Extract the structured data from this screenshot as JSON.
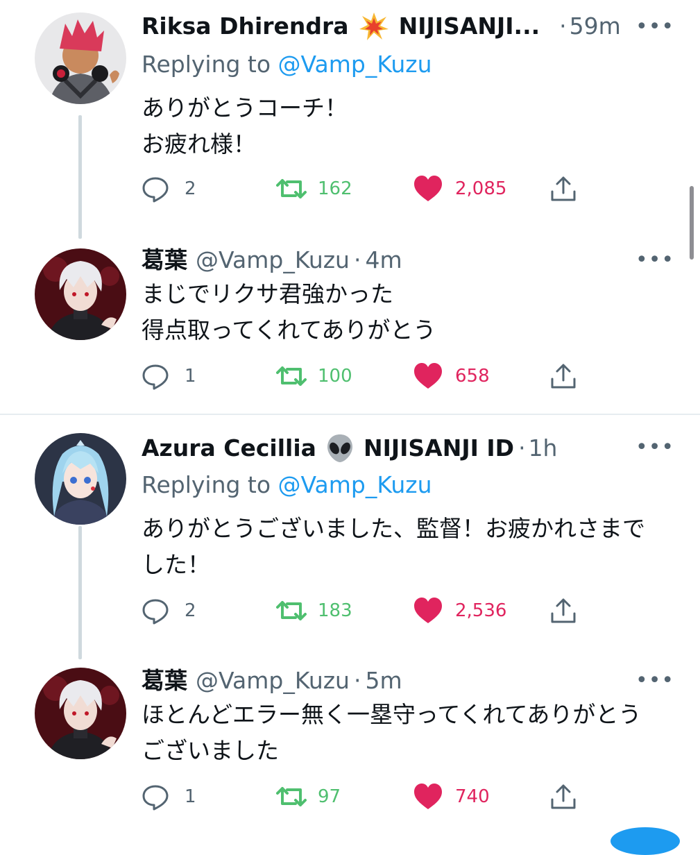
{
  "colors": {
    "accent": "#1d9bf0",
    "retweet": "#00ba7c",
    "like": "#f91880",
    "text": "#0f1419",
    "muted": "#536471"
  },
  "tweets": [
    {
      "name": "Riksa Dhirendra",
      "emoji_icon": "collision-emoji-icon",
      "name_suffix": "NIJISANJI...",
      "handle": "",
      "dot": "·",
      "time": "59m",
      "more": "•••",
      "reply_prefix": "Replying to ",
      "reply_handle": "@Vamp_Kuzu",
      "text_line1": "ありがとうコーチ！",
      "text_line2": "お疲れ様！",
      "replies": "2",
      "retweets": "162",
      "likes": "2,085"
    },
    {
      "name": "葛葉",
      "handle": "@Vamp_Kuzu",
      "dot": "·",
      "time": "4m",
      "more": "•••",
      "text_line1": "まじでリクサ君強かった",
      "text_line2": "得点取ってくれてありがとう",
      "replies": "1",
      "retweets": "100",
      "likes": "658"
    },
    {
      "name": "Azura Cecillia",
      "emoji_icon": "alien-emoji-icon",
      "name_suffix": "NIJISANJI ID",
      "handle": "",
      "dot": "·",
      "time": "1h",
      "more": "•••",
      "reply_prefix": "Replying to ",
      "reply_handle": "@Vamp_Kuzu",
      "text_line1": "ありがとうございました、監督！お疲かれさまで",
      "text_line2": "した！",
      "replies": "2",
      "retweets": "183",
      "likes": "2,536"
    },
    {
      "name": "葛葉",
      "handle": "@Vamp_Kuzu",
      "dot": "·",
      "time": "5m",
      "more": "•••",
      "text_line1": "ほとんどエラー無く一塁守ってくれてありがとう",
      "text_line2": "ございました",
      "replies": "1",
      "retweets": "97",
      "likes": "740"
    }
  ]
}
